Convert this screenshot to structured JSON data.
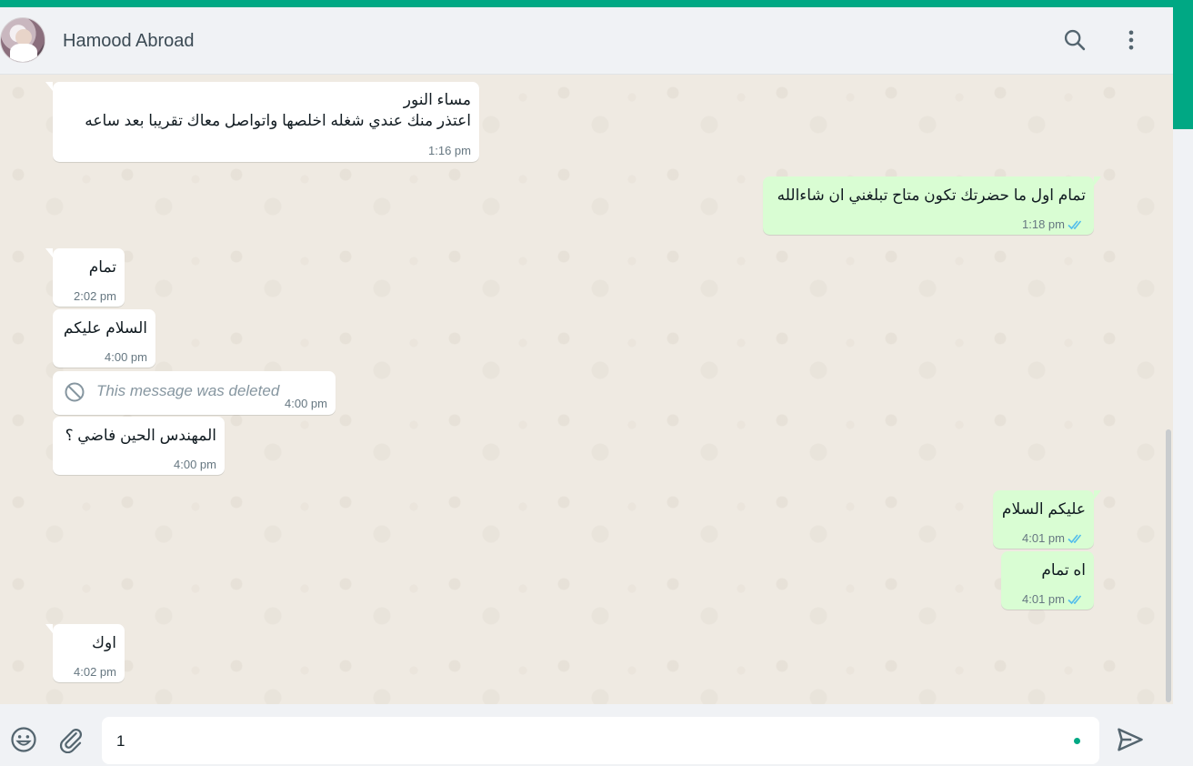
{
  "header": {
    "contact_name": "Hamood Abroad",
    "avatar_icon": "contact-avatar",
    "search_icon": "search-icon",
    "menu_icon": "kebab-menu-icon"
  },
  "messages": [
    {
      "direction": "in",
      "text": "مساء النور\nاعتذر منك عندي شغله اخلصها واتواصل معاك تقريبا بعد ساعه",
      "time": "1:16 pm"
    },
    {
      "direction": "out",
      "text": "تمام اول ما حضرتك تكون متاح تبلغني ان شاءالله",
      "time": "1:18 pm",
      "status": "read"
    },
    {
      "direction": "in",
      "text": "تمام",
      "time": "2:02 pm"
    },
    {
      "direction": "in",
      "text": "السلام عليكم",
      "time": "4:00 pm"
    },
    {
      "direction": "in",
      "deleted": true,
      "text": "This message was deleted",
      "time": "4:00 pm"
    },
    {
      "direction": "in",
      "text": "المهندس الحين فاضي ؟",
      "time": "4:00 pm"
    },
    {
      "direction": "out",
      "text": "عليكم السلام",
      "time": "4:01 pm",
      "status": "read"
    },
    {
      "direction": "out",
      "text": "اه تمام",
      "time": "4:01 pm",
      "status": "read"
    },
    {
      "direction": "in",
      "text": "اوك",
      "time": "4:02 pm"
    }
  ],
  "composer": {
    "value": "1",
    "emoji_icon": "emoji-icon",
    "attach_icon": "paperclip-icon",
    "send_icon": "send-icon"
  },
  "colors": {
    "accent": "#00a884",
    "incoming_bubble": "#ffffff",
    "outgoing_bubble": "#d9fdd3",
    "read_ticks": "#53bdeb",
    "chat_background": "#efeae2"
  }
}
